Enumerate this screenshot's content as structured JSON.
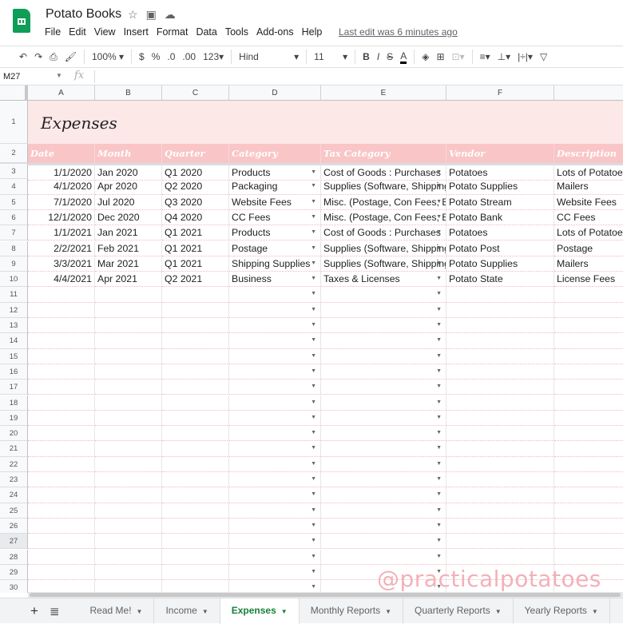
{
  "app": {
    "title": "Potato Books",
    "last_edit": "Last edit was 6 minutes ago"
  },
  "menu": [
    "File",
    "Edit",
    "View",
    "Insert",
    "Format",
    "Data",
    "Tools",
    "Add-ons",
    "Help"
  ],
  "toolbar": {
    "zoom": "100%",
    "currency": "$",
    "percent": "%",
    "dec_less": ".0",
    "dec_more": ".00",
    "format": "123",
    "font": "Hind",
    "font_size": "11",
    "bold": "B",
    "italic": "I",
    "strike": "S",
    "text_color": "A"
  },
  "formula_bar": {
    "cell_ref": "M27",
    "fx": "fx",
    "value": ""
  },
  "columns": [
    "A",
    "B",
    "C",
    "D",
    "E",
    "F",
    ""
  ],
  "sheet_title": "Expenses",
  "headers": [
    "Date",
    "Month",
    "Quarter",
    "Category",
    "Tax Category",
    "Vendor",
    "Description"
  ],
  "rows": [
    [
      "1/1/2020",
      "Jan 2020",
      "Q1 2020",
      "Products",
      "Cost of Goods : Purchases",
      "Potatoes",
      "Lots of Potatoes"
    ],
    [
      "4/1/2020",
      "Apr 2020",
      "Q2 2020",
      "Packaging",
      "Supplies (Software, Shipping",
      "Potato Supplies",
      "Mailers"
    ],
    [
      "7/1/2020",
      "Jul 2020",
      "Q3 2020",
      "Website Fees",
      "Misc. (Postage, Con Fees, Bank",
      "Potato Stream",
      "Website Fees"
    ],
    [
      "12/1/2020",
      "Dec 2020",
      "Q4 2020",
      "CC Fees",
      "Misc. (Postage, Con Fees, Bank",
      "Potato Bank",
      "CC Fees"
    ],
    [
      "1/1/2021",
      "Jan 2021",
      "Q1 2021",
      "Products",
      "Cost of Goods : Purchases",
      "Potatoes",
      "Lots of Potatoes"
    ],
    [
      "2/2/2021",
      "Feb 2021",
      "Q1 2021",
      "Postage",
      "Supplies (Software, Shipping",
      "Potato Post",
      "Postage"
    ],
    [
      "3/3/2021",
      "Mar 2021",
      "Q1 2021",
      "Shipping Supplies",
      "Supplies (Software, Shipping",
      "Potato Supplies",
      "Mailers"
    ],
    [
      "4/4/2021",
      "Apr 2021",
      "Q2 2021",
      "Business",
      "Taxes & Licenses",
      "Potato State",
      "License Fees"
    ]
  ],
  "selected_row": 27,
  "watermark": "@practicalpotatoes ♥",
  "tabs": [
    {
      "label": "Read Me!"
    },
    {
      "label": "Income"
    },
    {
      "label": "Expenses",
      "active": true
    },
    {
      "label": "Monthly Reports"
    },
    {
      "label": "Quarterly Reports"
    },
    {
      "label": "Yearly Reports"
    }
  ],
  "colors": {
    "header_bg": "#f9c5c7",
    "title_bg": "#fde8e8",
    "active_tab": "#188038"
  }
}
